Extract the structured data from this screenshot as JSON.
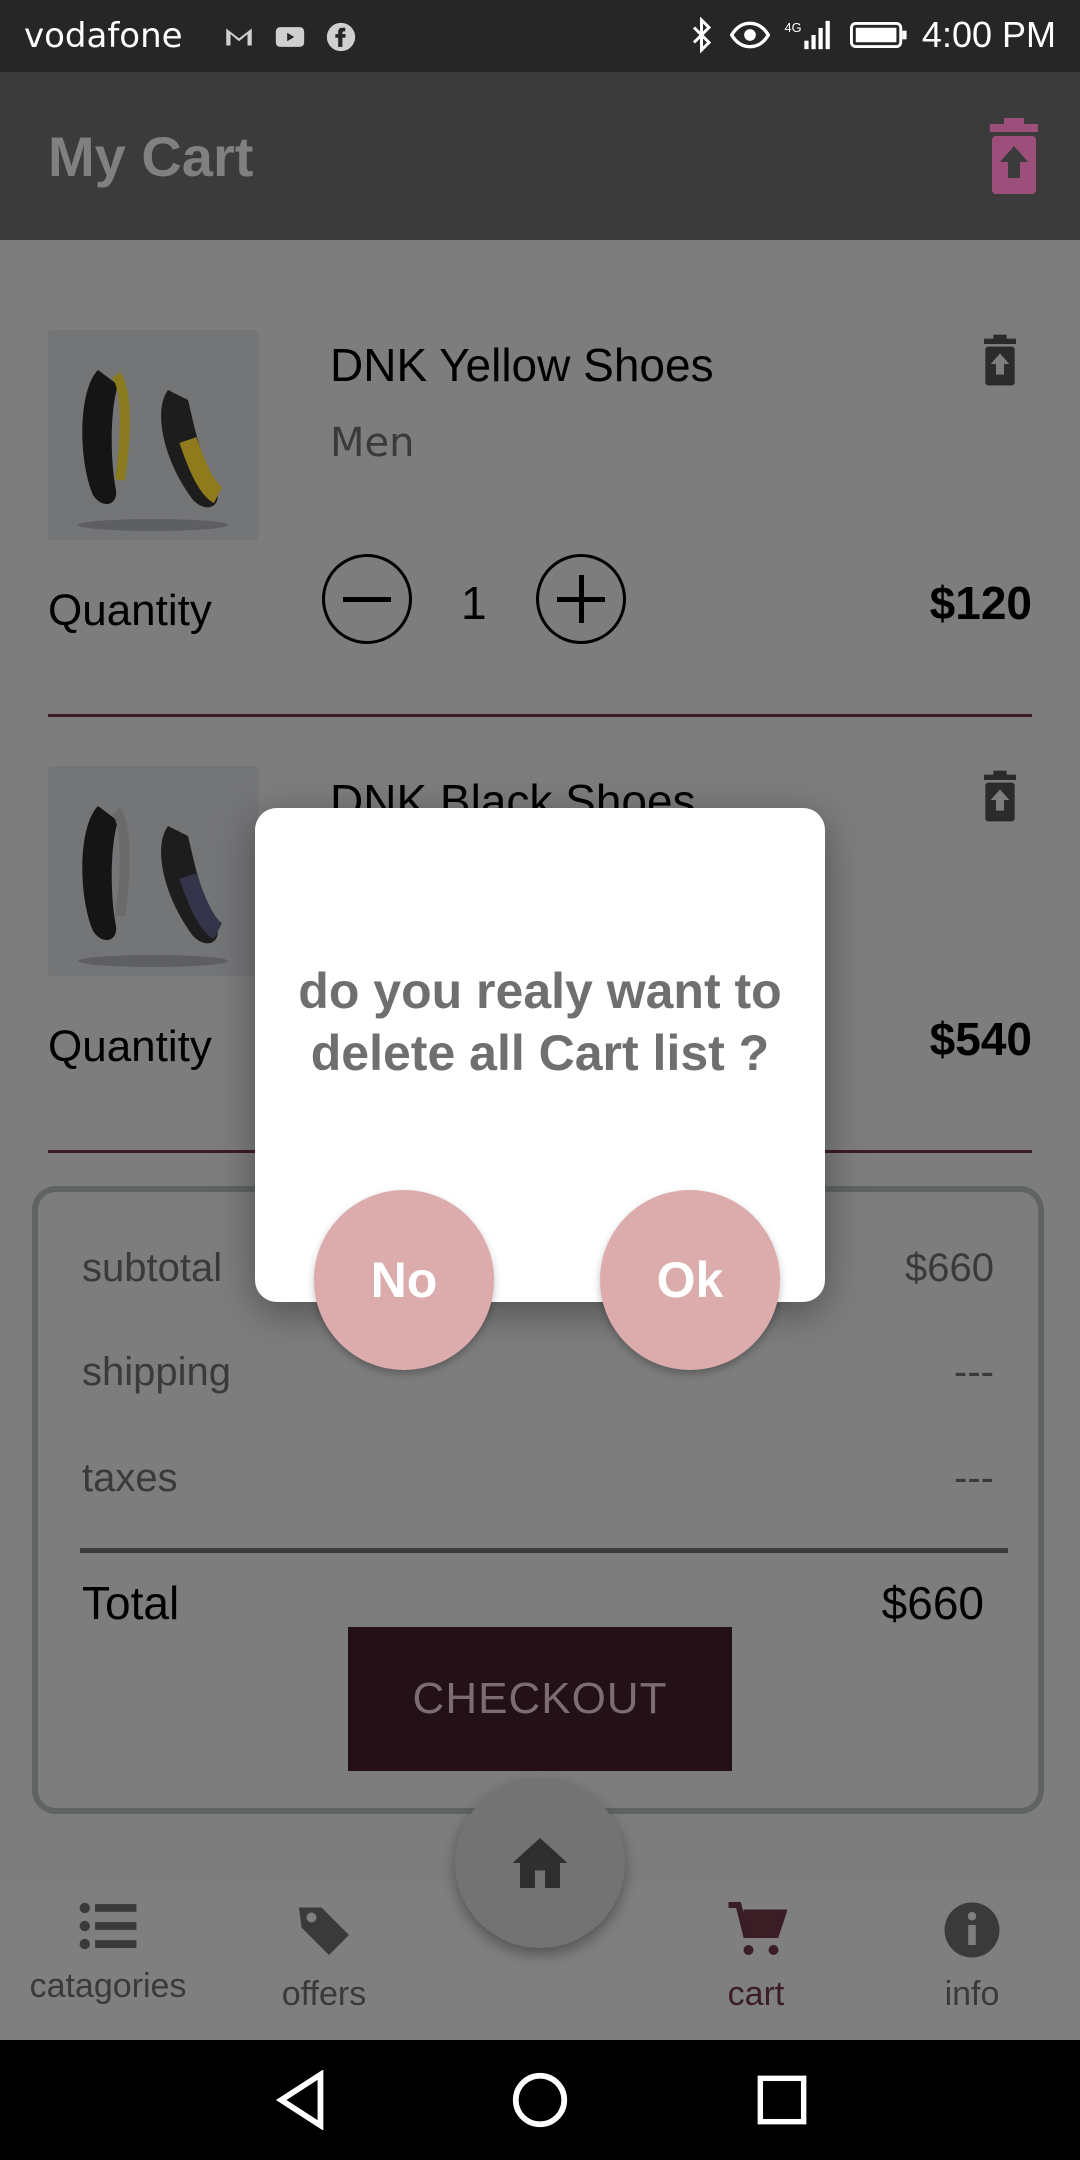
{
  "status_bar": {
    "carrier": "vodafone",
    "time": "4:00 PM",
    "icons": [
      "gmail-icon",
      "youtube-icon",
      "facebook-icon",
      "bluetooth-icon",
      "eye-icon",
      "signal-4g-icon",
      "battery-icon"
    ]
  },
  "app_bar": {
    "title": "My Cart",
    "delete_all_icon": "trash-can-icon",
    "accent": "#b85c8f"
  },
  "cart_items": [
    {
      "name": "DNK Yellow Shoes",
      "category": "Men",
      "quantity_label": "Quantity",
      "quantity": "1",
      "price": "$120"
    },
    {
      "name": "DNK Black Shoes",
      "quantity_label": "Quantity",
      "price": "$540"
    }
  ],
  "summary": {
    "subtotal_label": "subtotal",
    "subtotal_value": "$660",
    "shipping_label": "shipping",
    "shipping_value": "---",
    "taxes_label": "taxes",
    "taxes_value": "---",
    "total_label": "Total",
    "total_value": "$660",
    "checkout_label": "CHECKOUT"
  },
  "bottom_nav": {
    "home_icon": "home-icon",
    "tabs": [
      {
        "label": "catagories",
        "icon": "list-icon"
      },
      {
        "label": "offers",
        "icon": "tag-icon"
      },
      {
        "label": "cart",
        "icon": "cart-icon",
        "active": true
      },
      {
        "label": "info",
        "icon": "info-icon"
      }
    ],
    "active_color": "#3b1d26"
  },
  "dialog": {
    "message": "do you realy want to delete all Cart list ?",
    "no_label": "No",
    "ok_label": "Ok",
    "button_color": "#dcacad"
  }
}
